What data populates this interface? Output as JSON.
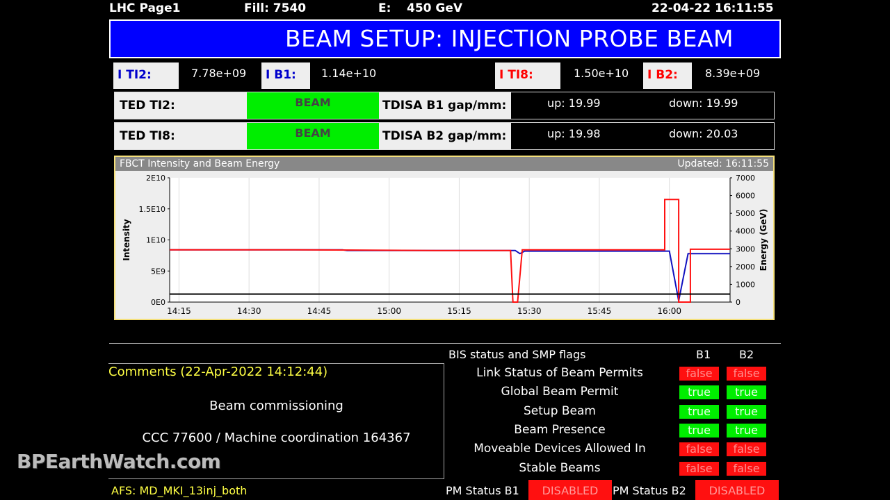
{
  "header": {
    "page": "LHC Page1",
    "fill": "Fill: 7540",
    "energy_label": "E:",
    "energy_value": "450 GeV",
    "datetime": "22-04-22 16:11:55"
  },
  "banner": {
    "title": "BEAM SETUP: INJECTION PROBE BEAM"
  },
  "intensities": {
    "ti2": {
      "label": "I TI2:",
      "value": "7.78e+09",
      "color": "#0000cc"
    },
    "b1": {
      "label": "I B1:",
      "value": "1.14e+10",
      "color": "#0000cc"
    },
    "ti8": {
      "label": "I TI8:",
      "value": "1.50e+10",
      "color": "#ff0000"
    },
    "b2": {
      "label": "I B2:",
      "value": "8.39e+09",
      "color": "#ff0000"
    }
  },
  "rows": [
    {
      "ted": "TED TI2:",
      "ted_state": "BEAM",
      "tdisa": "TDISA B1 gap/mm:",
      "up": "up:  19.99",
      "down": "down:  19.99"
    },
    {
      "ted": "TED TI8:",
      "ted_state": "BEAM",
      "tdisa": "TDISA B2 gap/mm:",
      "up": "up:  19.98",
      "down": "down:  20.03"
    }
  ],
  "chart": {
    "title": "FBCT Intensity and Beam Energy",
    "updated": "Updated: 16:11:55"
  },
  "chart_data": {
    "type": "line",
    "title": "FBCT Intensity and Beam Energy",
    "xlabel": "",
    "ylabel": "Intensity",
    "y2label": "Energy (GeV)",
    "x_ticks": [
      "14:15",
      "14:30",
      "14:45",
      "15:00",
      "15:15",
      "15:30",
      "15:45",
      "16:00"
    ],
    "y_ticks": [
      "0E0",
      "5E9",
      "1E10",
      "1.5E10",
      "2E10"
    ],
    "y2_ticks": [
      "0",
      "1000",
      "2000",
      "3000",
      "4000",
      "5000",
      "6000",
      "7000"
    ],
    "x_range_minutes": [
      853,
      973
    ],
    "ylim": [
      0,
      20000000000.0
    ],
    "y2lim": [
      0,
      7000
    ],
    "grid": true,
    "series": [
      {
        "color": "#1010c0",
        "axis": "left",
        "points": [
          [
            853,
            8400000000.0
          ],
          [
            890,
            8400000000.0
          ],
          [
            891,
            8300000000.0
          ],
          [
            927,
            8300000000.0
          ],
          [
            928,
            7800000000.0
          ],
          [
            929,
            8200000000.0
          ],
          [
            960,
            8200000000.0
          ],
          [
            962,
            200000000.0
          ],
          [
            964,
            7800000000.0
          ],
          [
            973,
            7800000000.0
          ]
        ]
      },
      {
        "color": "#ff1010",
        "axis": "left",
        "points": [
          [
            853,
            8400000000.0
          ],
          [
            880,
            8400000000.0
          ],
          [
            910,
            8300000000.0
          ],
          [
            926,
            8300000000.0
          ],
          [
            926.5,
            0
          ],
          [
            927.5,
            0
          ],
          [
            928.5,
            8400000000.0
          ],
          [
            945,
            8400000000.0
          ],
          [
            959,
            8400000000.0
          ],
          [
            959,
            16500000000.0
          ],
          [
            962,
            16500000000.0
          ],
          [
            962,
            0
          ],
          [
            964.5,
            0
          ],
          [
            964.5,
            8500000000.0
          ],
          [
            973,
            8500000000.0
          ]
        ]
      },
      {
        "color": "#000000",
        "axis": "right",
        "points": [
          [
            853,
            450
          ],
          [
            973,
            450
          ]
        ]
      }
    ]
  },
  "bis": {
    "title": "BIS status and SMP flags",
    "col_b1": "B1",
    "col_b2": "B2",
    "flags": [
      {
        "label": "Link Status of Beam Permits",
        "b1": "false",
        "b2": "false"
      },
      {
        "label": "Global Beam Permit",
        "b1": "true",
        "b2": "true"
      },
      {
        "label": "Setup Beam",
        "b1": "true",
        "b2": "true"
      },
      {
        "label": "Beam Presence",
        "b1": "true",
        "b2": "true"
      },
      {
        "label": "Moveable Devices Allowed In",
        "b1": "false",
        "b2": "false"
      },
      {
        "label": "Stable Beams",
        "b1": "false",
        "b2": "false"
      }
    ]
  },
  "comments": {
    "title": "Comments (22-Apr-2022 14:12:44)",
    "line1": "Beam commissioning",
    "line2": "CCC 77600 / Machine coordination 164367"
  },
  "watermark": "BPEarthWatch.com",
  "afs": "AFS: MD_MKI_13inj_both",
  "pm": {
    "b1_label": "PM Status B1",
    "b1_value": "DISABLED",
    "b2_label": "PM Status B2",
    "b2_value": "DISABLED"
  }
}
